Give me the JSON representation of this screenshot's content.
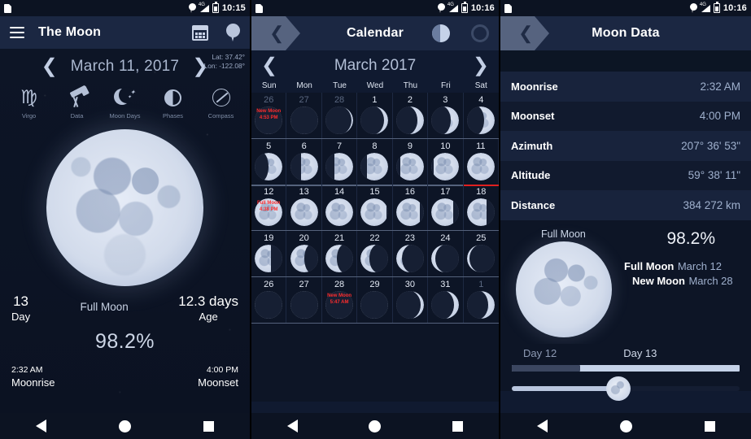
{
  "status_bar": {
    "icons": [
      "sim-card-icon",
      "location-pin-icon",
      "signal-4g-icon",
      "battery-icon"
    ],
    "network": "4G",
    "time_p1": "10:15",
    "time_p2": "10:16",
    "time_p3": "10:16"
  },
  "panel1": {
    "app_title": "The Moon",
    "actions": [
      "calendar-icon",
      "location-pin-icon"
    ],
    "date": "March 11, 2017",
    "lat": "Lat: 37.42°",
    "lon": "Lon: -122.08°",
    "quick_items": [
      {
        "label": "Virgo",
        "icon": "virgo-zodiac-icon",
        "glyph": "♍"
      },
      {
        "label": "Data",
        "icon": "telescope-icon"
      },
      {
        "label": "Moon Days",
        "icon": "crescent-moon-stars-icon"
      },
      {
        "label": "Phases",
        "icon": "half-moon-icon"
      },
      {
        "label": "Compass",
        "icon": "compass-icon"
      }
    ],
    "day_number": "13",
    "day_label": "Day",
    "age_value": "12.3 days",
    "age_label": "Age",
    "phase_name": "Full Moon",
    "illumination": "98.2%",
    "moonrise_time": "2:32 AM",
    "moonrise_label": "Moonrise",
    "moonset_time": "4:00 PM",
    "moonset_label": "Moonset"
  },
  "panel2": {
    "title": "Calendar",
    "actions": [
      "moon-phase-icon",
      "dial-icon"
    ],
    "month": "March 2017",
    "prev_icon": "chevron-left-icon",
    "next_icon": "chevron-right-icon",
    "weekdays": [
      "Sun",
      "Mon",
      "Tue",
      "Wed",
      "Thu",
      "Fri",
      "Sat"
    ],
    "today": 11,
    "today_col": 6,
    "today_row": 1,
    "weeks": [
      [
        {
          "n": "26",
          "out": true,
          "illum": 0.02,
          "wax": true,
          "note": "New Moon\n4:53 PM"
        },
        {
          "n": "27",
          "out": true,
          "illum": 0.01,
          "wax": true
        },
        {
          "n": "28",
          "out": true,
          "illum": 0.03,
          "wax": true
        },
        {
          "n": "1",
          "out": false,
          "illum": 0.12,
          "wax": true
        },
        {
          "n": "2",
          "out": false,
          "illum": 0.2,
          "wax": true
        },
        {
          "n": "3",
          "out": false,
          "illum": 0.28,
          "wax": true
        },
        {
          "n": "4",
          "out": false,
          "illum": 0.37,
          "wax": true
        }
      ],
      [
        {
          "n": "5",
          "out": false,
          "illum": 0.47,
          "wax": true
        },
        {
          "n": "6",
          "out": false,
          "illum": 0.57,
          "wax": true
        },
        {
          "n": "7",
          "out": false,
          "illum": 0.66,
          "wax": true
        },
        {
          "n": "8",
          "out": false,
          "illum": 0.75,
          "wax": true
        },
        {
          "n": "9",
          "out": false,
          "illum": 0.83,
          "wax": true
        },
        {
          "n": "10",
          "out": false,
          "illum": 0.9,
          "wax": true
        },
        {
          "n": "11",
          "out": false,
          "illum": 0.96,
          "wax": true
        }
      ],
      [
        {
          "n": "12",
          "out": false,
          "illum": 1.0,
          "wax": true,
          "note": "Full Moon\n4:38 PM"
        },
        {
          "n": "13",
          "out": false,
          "illum": 0.99,
          "wax": false
        },
        {
          "n": "14",
          "out": false,
          "illum": 0.96,
          "wax": false
        },
        {
          "n": "15",
          "out": false,
          "illum": 0.91,
          "wax": false
        },
        {
          "n": "16",
          "out": false,
          "illum": 0.84,
          "wax": false
        },
        {
          "n": "17",
          "out": false,
          "illum": 0.76,
          "wax": false
        },
        {
          "n": "18",
          "out": false,
          "illum": 0.66,
          "wax": false
        }
      ],
      [
        {
          "n": "19",
          "out": false,
          "illum": 0.56,
          "wax": false
        },
        {
          "n": "20",
          "out": false,
          "illum": 0.47,
          "wax": false
        },
        {
          "n": "21",
          "out": false,
          "illum": 0.37,
          "wax": false
        },
        {
          "n": "22",
          "out": false,
          "illum": 0.27,
          "wax": false
        },
        {
          "n": "23",
          "out": false,
          "illum": 0.18,
          "wax": false
        },
        {
          "n": "24",
          "out": false,
          "illum": 0.11,
          "wax": false
        },
        {
          "n": "25",
          "out": false,
          "illum": 0.05,
          "wax": false
        }
      ],
      [
        {
          "n": "26",
          "out": false,
          "illum": 0.02,
          "wax": false
        },
        {
          "n": "27",
          "out": false,
          "illum": 0.01,
          "wax": false
        },
        {
          "n": "28",
          "out": false,
          "illum": 0.0,
          "wax": true,
          "note": "New Moon\n5:47 AM"
        },
        {
          "n": "29",
          "out": false,
          "illum": 0.02,
          "wax": true
        },
        {
          "n": "30",
          "out": false,
          "illum": 0.08,
          "wax": true
        },
        {
          "n": "31",
          "out": false,
          "illum": 0.15,
          "wax": true
        },
        {
          "n": "1",
          "out": true,
          "illum": 0.22,
          "wax": true
        }
      ]
    ]
  },
  "panel3": {
    "title": "Moon Data",
    "rows": [
      {
        "key": "Moonrise",
        "value": "2:32 AM"
      },
      {
        "key": "Moonset",
        "value": "4:00 PM"
      },
      {
        "key": "Azimuth",
        "value": "207° 36' 53\""
      },
      {
        "key": "Altitude",
        "value": "59° 38' 11\""
      },
      {
        "key": "Distance",
        "value": "384 272 km"
      }
    ],
    "phase_label": "Full Moon",
    "illumination": "98.2%",
    "events": [
      {
        "name": "Full Moon",
        "date": "March  12"
      },
      {
        "name": "New Moon",
        "date": "March  28"
      }
    ],
    "day_left": "Day 12",
    "day_right": "Day 13"
  },
  "navbar": {
    "back": "back-triangle-icon",
    "home": "home-circle-icon",
    "recents": "recents-square-icon"
  },
  "colors": {
    "appbar": "#1b2742",
    "background": "#0d1526",
    "accent_red": "#ff2d2d",
    "text_primary": "#ffffff",
    "text_secondary": "#9fb0cd"
  }
}
